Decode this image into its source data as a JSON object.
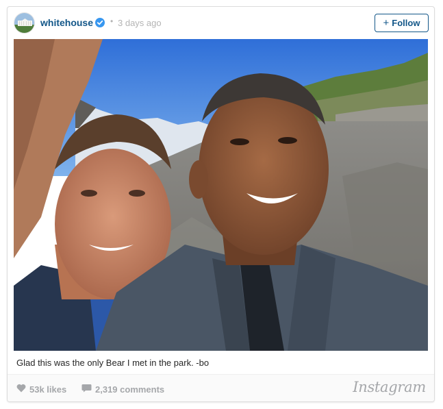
{
  "post": {
    "username": "whitehouse",
    "separator": "•",
    "timestamp": "3 days ago",
    "follow_label": "Follow",
    "follow_plus": "+",
    "caption": "Glad this was the only Bear I met in the park. -bo",
    "likes": "53k likes",
    "comments": "2,319 comments",
    "brand": "Instagram"
  },
  "icons": {
    "verified": "verified-badge-icon",
    "likes": "heart-icon",
    "comments": "comment-bubble-icon"
  },
  "colors": {
    "username": "#125688",
    "verified": "#3897f0",
    "muted": "#b4b4b4",
    "footer_text": "#a5a7aa"
  }
}
